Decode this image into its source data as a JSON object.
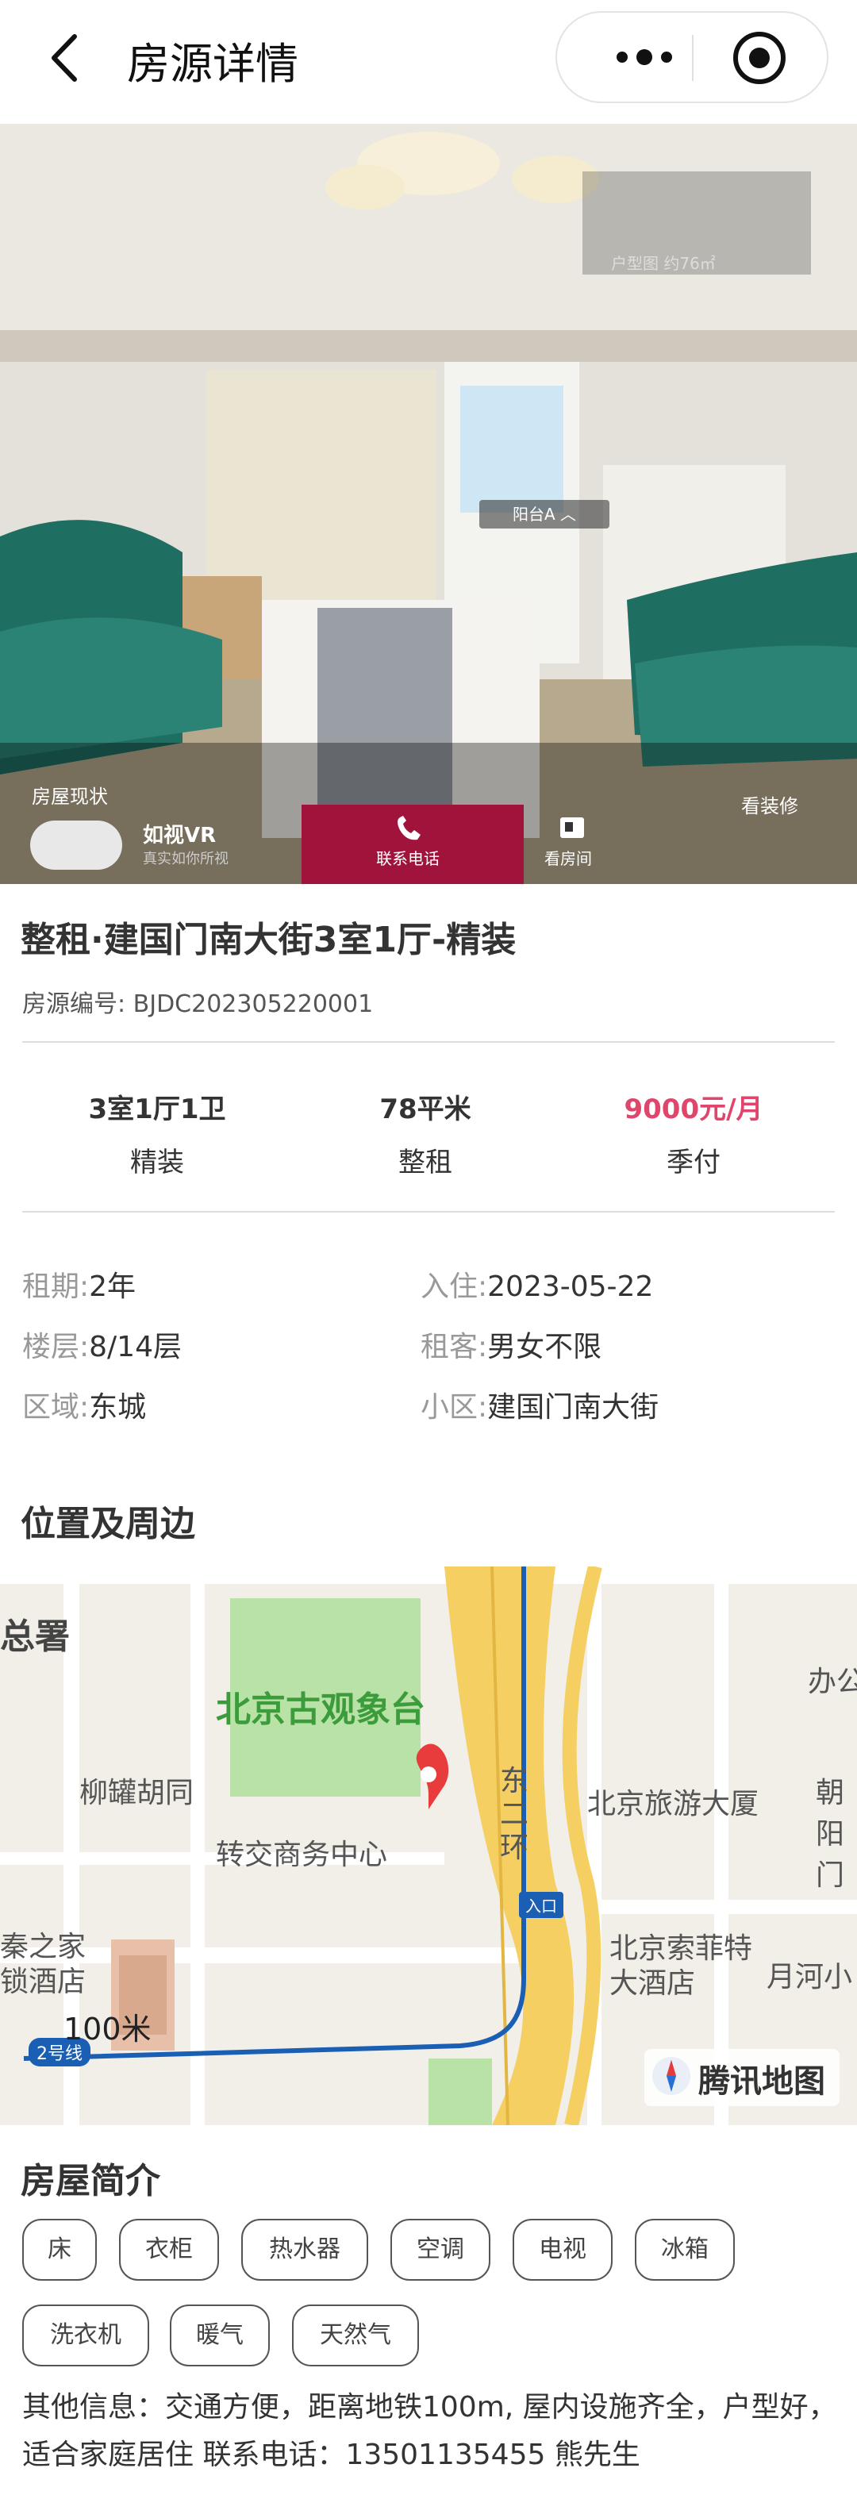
{
  "topbar": {
    "title": "房源详情"
  },
  "hero": {
    "floorplan_label": "户型图  约76㎡",
    "balcony_tag": "阳台A ︿",
    "status_label": "房屋现状",
    "decor_label": "看装修",
    "vr_title": "如视VR",
    "vr_subtitle": "真实如你所视",
    "call_label": "联系电话",
    "viewroom_label": "看房间"
  },
  "listing": {
    "title": "整租·建国门南大街3室1厅-精装",
    "number_label": "房源编号:",
    "number": "BJDC202305220001"
  },
  "stats": [
    {
      "value": "3室1厅1卫",
      "sub": "精装"
    },
    {
      "value": "78平米",
      "sub": "整租"
    },
    {
      "value": "9000元/月",
      "sub": "季付"
    }
  ],
  "details": {
    "lease_label": "租期:",
    "lease": "2年",
    "movein_label": "入住:",
    "movein": "2023-05-22",
    "floor_label": "楼层:",
    "floor": "8/14层",
    "tenant_label": "租客:",
    "tenant": "男女不限",
    "district_label": "区域:",
    "district": "东城",
    "community_label": "小区:",
    "community": "建国门南大街"
  },
  "location": {
    "section_title": "位置及周边",
    "labels": {
      "zongshu": "总署",
      "observatory": "北京古观象台",
      "liuguan": "柳罐胡同",
      "business_center": "转交商务中心",
      "ring": "东二环",
      "travel_bldg": "北京旅游大厦",
      "chaoyang": "朝阳门",
      "ban": "办公",
      "entrance": "入口",
      "sofitel": "北京索菲特大酒店",
      "yuehe": "月河小",
      "qin": "秦之家",
      "hotel_left": "锁酒店",
      "line2": "2号线"
    },
    "scale": "100米",
    "provider": "腾讯地图"
  },
  "intro": {
    "section_title": "房屋简介",
    "tags": [
      "床",
      "衣柜",
      "热水器",
      "空调",
      "电视",
      "冰箱",
      "洗衣机",
      "暖气",
      "天然气"
    ],
    "other_info": "其他信息：交通方便，距离地铁100m, 屋内设施齐全，户型好，适合家庭居住 联系电话：13501135455 熊先生"
  },
  "colors": {
    "price": "#e0456b",
    "map_green": "#3c9c3c",
    "subway_blue": "#1a5fb4"
  }
}
